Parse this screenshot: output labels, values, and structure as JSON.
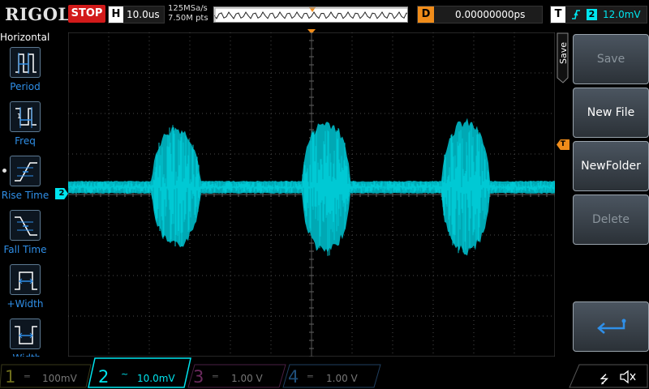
{
  "header": {
    "brand": "RIGOL",
    "run_state": "STOP",
    "timebase_letter": "H",
    "timebase": "10.0us",
    "sample_rate": "125MSa/s",
    "mem_depth": "7.50M pts",
    "delay_letter": "D",
    "delay": "0.00000000ps",
    "trigger_letter": "T",
    "trigger_source": "2",
    "trigger_level": "12.0mV"
  },
  "left_panel": {
    "title": "Horizontal",
    "items": [
      {
        "label": "Period",
        "icon": "period-icon"
      },
      {
        "label": "Freq",
        "icon": "freq-icon"
      },
      {
        "label": "Rise Time",
        "icon": "rise-time-icon"
      },
      {
        "label": "Fall Time",
        "icon": "fall-time-icon"
      },
      {
        "label": "+Width",
        "icon": "pos-width-icon"
      },
      {
        "label": "-Width",
        "icon": "neg-width-icon"
      }
    ]
  },
  "markers": {
    "channel_marker": "2",
    "trigger_marker": "T"
  },
  "right_menu": {
    "title": "Save",
    "buttons": [
      {
        "label": "Save",
        "enabled": false
      },
      {
        "label": "New File",
        "enabled": true
      },
      {
        "label": "NewFolder",
        "enabled": true
      },
      {
        "label": "Delete",
        "enabled": false
      },
      {
        "label": "",
        "icon": "return-arrow-icon",
        "enabled": true
      }
    ]
  },
  "channels": [
    {
      "num": "1",
      "coupling": "═",
      "scale": "100mV",
      "color": "#6e6e1c",
      "active": false
    },
    {
      "num": "2",
      "coupling": "~",
      "scale": "10.0mV",
      "color": "#00e5ef",
      "active": true
    },
    {
      "num": "3",
      "coupling": "═",
      "scale": "1.00 V",
      "color": "#6b2a5e",
      "active": false
    },
    {
      "num": "4",
      "coupling": "═",
      "scale": "1.00 V",
      "color": "#1f4f7a",
      "active": false
    }
  ],
  "colors": {
    "ch2": "#00e5ef",
    "trigger": "#f08c1a",
    "stop": "#d21a1a",
    "grid": "#5a5a5a",
    "menu_label": "#2f8fe8"
  },
  "status_icons": [
    "usb-icon",
    "sound-muted-icon"
  ]
}
